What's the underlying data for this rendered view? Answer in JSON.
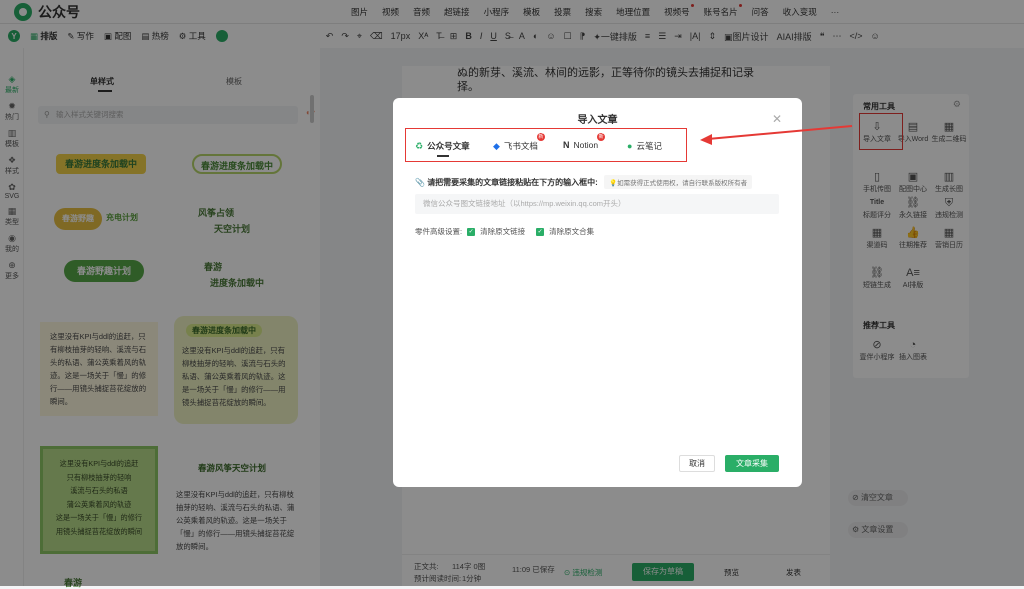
{
  "app": {
    "name": "公众号"
  },
  "top_menu": [
    "图片",
    "视频",
    "音频",
    "超链接",
    "小程序",
    "模板",
    "投票",
    "搜索",
    "地理位置",
    "视频号",
    "账号名片",
    "问答",
    "收入变现",
    "···"
  ],
  "left_tools": {
    "paiban": "排版",
    "xiezuo": "写作",
    "peitu": "配图",
    "rebang": "热榜",
    "gongju": "工具"
  },
  "format_toolbar": {
    "fontsize": "17px",
    "yijianpaiban": "一键排版",
    "tupiansheji": "图片设计",
    "aipaiban": "AI排版"
  },
  "sidebar": [
    {
      "icon": "diamond-icon",
      "label": "最新"
    },
    {
      "icon": "fire-icon",
      "label": "热门"
    },
    {
      "icon": "template-icon",
      "label": "模板"
    },
    {
      "icon": "style-icon",
      "label": "样式"
    },
    {
      "icon": "svg-icon",
      "label": "SVG"
    },
    {
      "icon": "grid-icon",
      "label": "类型"
    },
    {
      "icon": "user-icon",
      "label": "我的"
    },
    {
      "icon": "more-icon",
      "label": "更多"
    }
  ],
  "panel": {
    "tabs": [
      "单样式",
      "模板"
    ],
    "search_placeholder": "输入样式关键词搜索"
  },
  "style_items": {
    "b1": "春游进度条加载中",
    "b2": "春游进度条加载中",
    "b3": "春游野趣",
    "b3b": "充电计划",
    "b4a": "风筝占领",
    "b4b": "天空计划",
    "b5": "春游野趣计划",
    "b6a": "春游",
    "b6b": "进度条加载中",
    "b7": "春游进度条加载中",
    "b8": "春游风筝天空计划",
    "card1": "这里没有KPI与ddl的追赶，只有柳枝抽芽的轻响、溪流与石头的私语、蒲公英乘着风的轨迹。这是一场关于「慢」的修行——用镜头捕捉苔花绽放的瞬间。",
    "card2": "这里没有KPI与ddl的追赶，只有柳枝抽芽的轻响、溪流与石头的私语、蒲公英乘着风的轨迹。这是一场关于「慢」的修行——用镜头捕捉苔花绽放的瞬间。",
    "card3": [
      "这里没有KPI与ddl的追赶",
      "只有柳枝抽芽的轻响",
      "溪流与石头的私语",
      "蒲公英乘着风的轨迹",
      "这是一场关于「慢」的修行",
      "用镜头捕捉苔花绽放的瞬间"
    ],
    "card4": "这里没有KPI与ddl的追赶，只有柳枝抽芽的轻响、溪流与石头的私语、蒲公英乘着风的轨迹。这是一场关于「慢」的修行——用镜头捕捉苔花绽放的瞬间。",
    "b9": "春游"
  },
  "editor": {
    "body_line1": "ぬ的新芽、溪流、林间的远影，正等待你的镜头去捕捉和记录",
    "body_line2": "择。"
  },
  "bottom": {
    "words_label": "正文共:",
    "words_value": "114字 0图",
    "time_label": "预计阅读时间:",
    "time_value": "1分钟",
    "saved": "11:09 已保存",
    "check": "违规检测",
    "save_btn": "保存为草稿",
    "preview": "预览",
    "publish": "发表"
  },
  "tools": {
    "common_title": "常用工具",
    "items": [
      "导入文章",
      "导入Word",
      "生成二维码",
      "手机传图",
      "配图中心",
      "生成长图",
      "标题评分",
      "永久链接",
      "违规检测",
      "渠道码",
      "往期推荐",
      "营销日历",
      "短链生成",
      "AI排版"
    ],
    "icons": [
      "import-icon",
      "word-icon",
      "qrcode-icon",
      "phone-icon",
      "image-icon",
      "long-image-icon",
      "title-icon",
      "link-icon",
      "shield-icon",
      "channel-code-icon",
      "recommend-icon",
      "calendar-icon",
      "shortlink-icon",
      "ai-icon"
    ],
    "rec_title": "推荐工具",
    "rec_items": [
      "壹伴小程序",
      "插入图表"
    ],
    "clear": "清空文章",
    "settings": "文章设置"
  },
  "modal": {
    "title": "导入文章",
    "tabs": [
      "公众号文章",
      "飞书文档",
      "Notion",
      "云笔记"
    ],
    "badge": "新",
    "hint": "请把需要采集的文章链接粘贴在下方的输入框中:",
    "hint2": "如需获得正式使用权，请自行联系版权所有者",
    "placeholder": "微信公众号图文链接地址（以https://mp.weixin.qq.com开头）",
    "adv_label": "零件高级设置:",
    "opt1": "清除原文链接",
    "opt2": "清除原文合集",
    "cancel": "取消",
    "confirm": "文章采集"
  },
  "colors": {
    "brand": "#2aae67",
    "annotation": "#e53935"
  }
}
